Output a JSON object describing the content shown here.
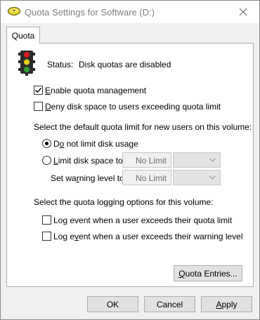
{
  "window": {
    "title": "Quota Settings for Software (D:)"
  },
  "tabs": [
    {
      "label": "Quota"
    }
  ],
  "status": {
    "label": "Status:",
    "value": "Disk quotas are disabled"
  },
  "options": {
    "enable_quota": {
      "pre": "",
      "key": "E",
      "post": "nable quota management",
      "checked": true
    },
    "deny_space": {
      "pre": "",
      "key": "D",
      "post": "eny disk space to users exceeding quota limit",
      "checked": false
    }
  },
  "default_limit": {
    "heading": "Select the default quota limit for new users on this volume:",
    "no_limit": {
      "pre": "D",
      "key": "o",
      "post": " not limit disk usage",
      "selected": true
    },
    "limit_to": {
      "pre": "",
      "key": "L",
      "post": "imit disk space to",
      "selected": false,
      "value": "No Limit"
    },
    "warning": {
      "pre": "Set wa",
      "key": "r",
      "post": "ning level to",
      "value": "No Limit"
    }
  },
  "logging": {
    "heading": "Select the quota logging options for this volume:",
    "exceeds_limit": {
      "pre": "Lo",
      "key": "g",
      "post": " event when a user exceeds their quota limit",
      "checked": false
    },
    "exceeds_warning": {
      "pre": "Log e",
      "key": "v",
      "post": "ent when a user exceeds their warning level",
      "checked": false
    }
  },
  "buttons": {
    "quota_entries": {
      "pre": "",
      "key": "Q",
      "post": "uota Entries..."
    },
    "ok": "OK",
    "cancel": "Cancel",
    "apply": {
      "pre": "",
      "key": "A",
      "post": "pply"
    }
  },
  "icons": {
    "title": "disk-drive-icon",
    "status": "traffic-light-icon",
    "close": "close-icon",
    "dropdown": "chevron-down-icon"
  },
  "colors": {
    "traffic_red": "#d81e1e",
    "traffic_yellow": "#e8d21c",
    "traffic_green": "#2fa02f"
  }
}
